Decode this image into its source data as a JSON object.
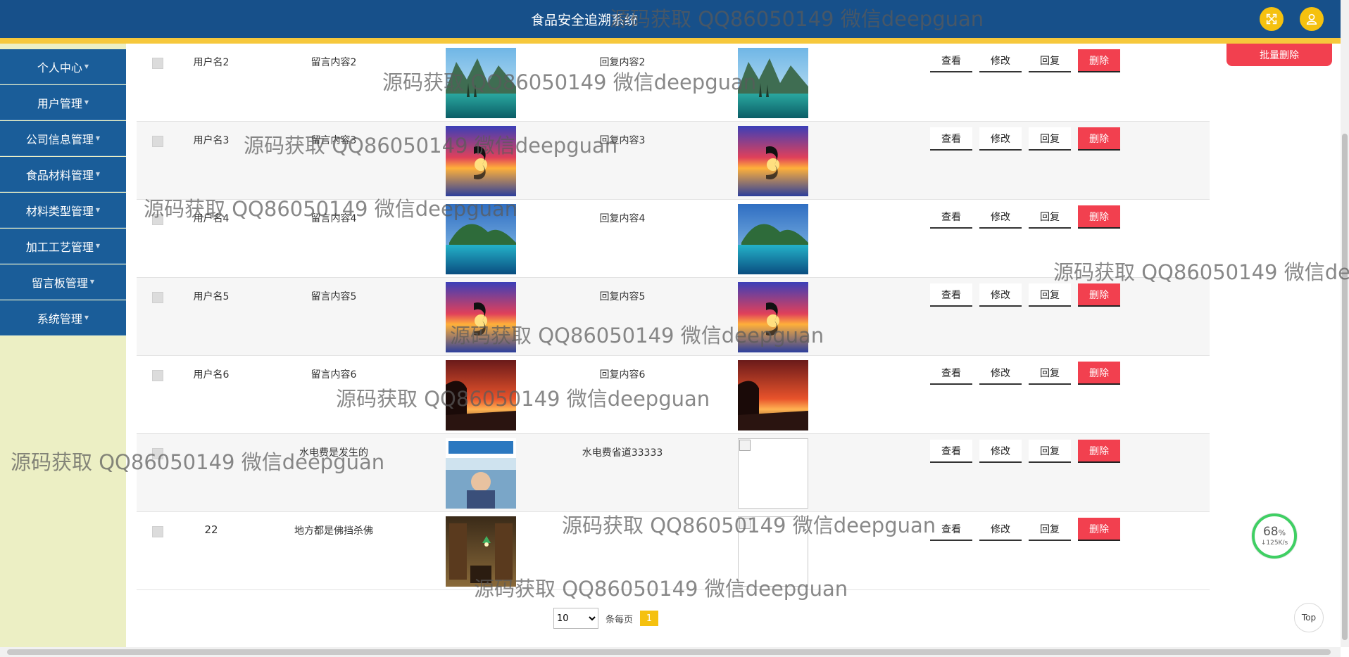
{
  "header": {
    "title": "食品安全追溯系统"
  },
  "sidebar": {
    "items": [
      {
        "label": "个人中心"
      },
      {
        "label": "用户管理"
      },
      {
        "label": "公司信息管理"
      },
      {
        "label": "食品材料管理"
      },
      {
        "label": "材料类型管理"
      },
      {
        "label": "加工工艺管理"
      },
      {
        "label": "留言板管理"
      },
      {
        "label": "系统管理"
      }
    ]
  },
  "toolbar": {
    "batch_delete_label": "批量删除"
  },
  "actions": {
    "view": "查看",
    "edit": "修改",
    "reply": "回复",
    "delete": "删除"
  },
  "rows": [
    {
      "username": "用户名2",
      "message": "留言内容2",
      "reply": "回复内容2"
    },
    {
      "username": "用户名3",
      "message": "留言内容3",
      "reply": "回复内容3"
    },
    {
      "username": "用户名4",
      "message": "留言内容4",
      "reply": "回复内容4"
    },
    {
      "username": "用户名5",
      "message": "留言内容5",
      "reply": "回复内容5"
    },
    {
      "username": "用户名6",
      "message": "留言内容6",
      "reply": "回复内容6"
    },
    {
      "username": "",
      "message": "水电费是发生的",
      "reply": "水电费省道33333"
    },
    {
      "username": "22",
      "message": "地方都是佛挡杀佛",
      "reply": ""
    }
  ],
  "pagination": {
    "page_size": "10",
    "page_size_options": [
      "10"
    ],
    "per_page_label": "条每页",
    "current_page": "1"
  },
  "speed_widget": {
    "percent": "68",
    "percent_unit": "%",
    "rate": "↓125K/s"
  },
  "top_button": {
    "label": "Top"
  },
  "watermark": {
    "text": "源码获取 QQ86050149 微信deepguan"
  }
}
